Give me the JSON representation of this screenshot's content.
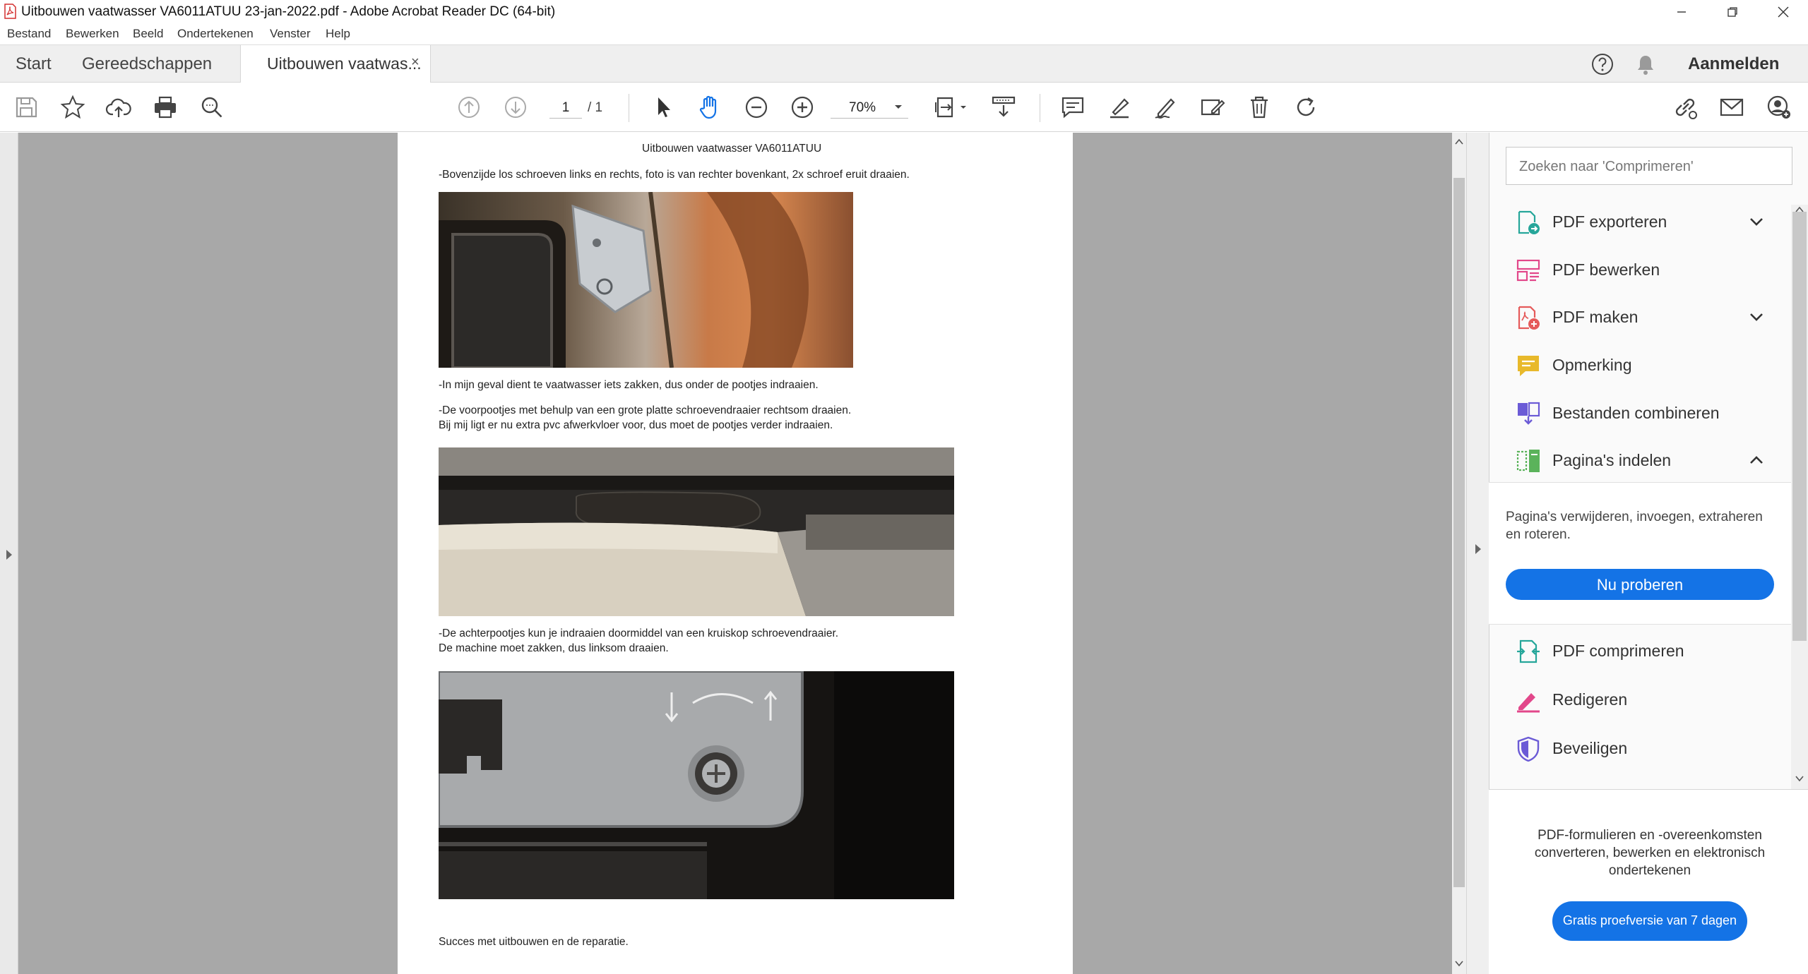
{
  "window": {
    "title": "Uitbouwen vaatwasser VA6011ATUU  23-jan-2022.pdf - Adobe Acrobat Reader DC (64-bit)"
  },
  "menu": [
    "Bestand",
    "Bewerken",
    "Beeld",
    "Ondertekenen",
    "Venster",
    "Help"
  ],
  "tabs": {
    "start": "Start",
    "tools": "Gereedschappen",
    "document": "Uitbouwen vaatwas...",
    "close": "×",
    "signin": "Aanmelden"
  },
  "toolbar": {
    "page_current": "1",
    "page_total": "/ 1",
    "zoom": "70%"
  },
  "document": {
    "heading": "Uitbouwen vaatwasser VA6011ATUU",
    "p1": "-Bovenzijde los schroeven links en rechts, foto is van rechter bovenkant, 2x schroef eruit draaien.",
    "p2": "-In mijn geval dient te vaatwasser iets zakken, dus onder de pootjes indraaien.",
    "p3a": "-De voorpootjes met behulp van een grote platte schroevendraaier rechtsom draaien.",
    "p3b": "  Bij mij ligt er nu extra pvc afwerkvloer voor, dus moet de pootjes verder indraaien.",
    "p4a": "-De achterpootjes kun je indraaien doormiddel van een kruiskop schroevendraaier.",
    "p4b": "  De machine moet zakken, dus linksom draaien.",
    "p5": "Succes met uitbouwen en de reparatie."
  },
  "panel": {
    "search_placeholder": "Zoeken naar 'Comprimeren'",
    "tools": [
      {
        "name": "PDF exporteren",
        "icon": "export-pdf-icon",
        "color": "#26a69a"
      },
      {
        "name": "PDF bewerken",
        "icon": "edit-pdf-icon",
        "color": "#e2478a"
      },
      {
        "name": "PDF maken",
        "icon": "create-pdf-icon",
        "color": "#e55a5a"
      },
      {
        "name": "Opmerking",
        "icon": "comment-icon",
        "color": "#e8b92b"
      },
      {
        "name": "Bestanden combineren",
        "icon": "combine-files-icon",
        "color": "#6b5bd6"
      },
      {
        "name": "Pagina's indelen",
        "icon": "organize-pages-icon",
        "color": "#5bb35b"
      },
      {
        "name": "PDF comprimeren",
        "icon": "compress-pdf-icon",
        "color": "#26a69a"
      },
      {
        "name": "Redigeren",
        "icon": "redact-icon",
        "color": "#e2478a"
      },
      {
        "name": "Beveiligen",
        "icon": "protect-icon",
        "color": "#6b5bd6"
      }
    ],
    "organize_desc": "Pagina's verwijderen, invoegen, extraheren en roteren.",
    "try_button": "Nu proberen",
    "promo_text": "PDF-formulieren en -overeenkomsten converteren, bewerken en elektronisch ondertekenen",
    "promo_button": "Gratis proefversie van 7 dagen",
    "accent": "#1473e6"
  }
}
